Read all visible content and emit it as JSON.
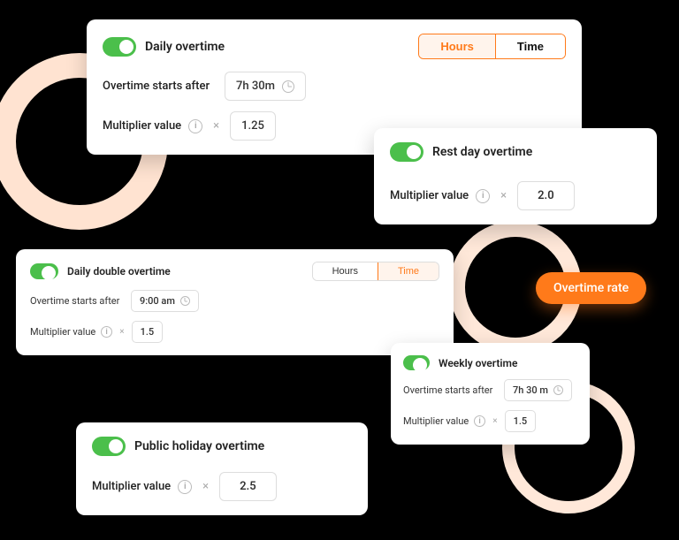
{
  "colors": {
    "accent": "#ff7a1a",
    "toggle_on": "#4bbf4b"
  },
  "common": {
    "overtime_starts_label": "Overtime starts after",
    "multiplier_label": "Multiplier value",
    "times_symbol": "×",
    "info_symbol": "i"
  },
  "segment": {
    "hours": "Hours",
    "time": "Time"
  },
  "pill_label": "Overtime rate",
  "cards": {
    "daily": {
      "title": "Daily overtime",
      "starts_value": "7h 30m",
      "multiplier_value": "1.25",
      "segment_active": "hours"
    },
    "rest_day": {
      "title": "Rest day overtime",
      "multiplier_value": "2.0"
    },
    "daily_double": {
      "title": "Daily double overtime",
      "starts_value": "9:00 am",
      "multiplier_value": "1.5",
      "segment_active": "time"
    },
    "weekly": {
      "title": "Weekly overtime",
      "starts_value": "7h 30 m",
      "multiplier_value": "1.5"
    },
    "public_holiday": {
      "title": "Public holiday overtime",
      "multiplier_value": "2.5"
    }
  }
}
